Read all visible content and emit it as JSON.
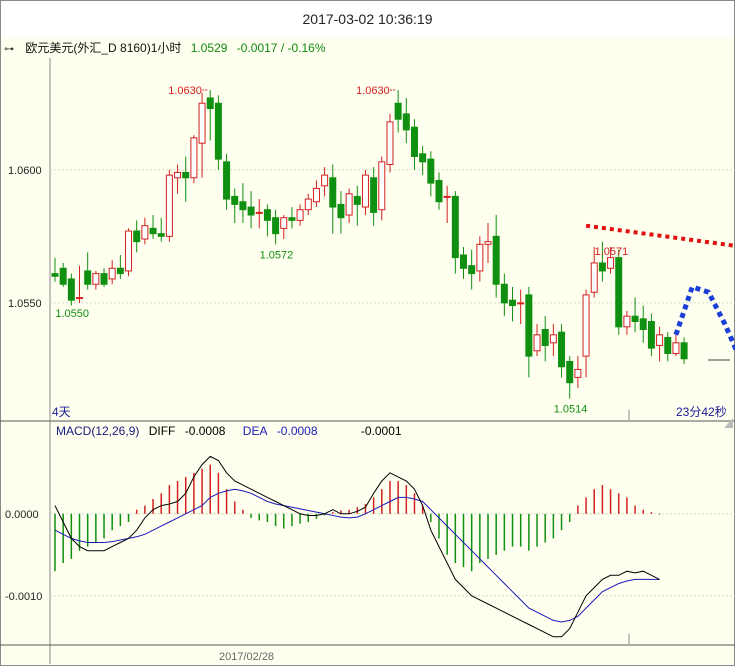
{
  "title": "2017-03-02 10:36:19",
  "header": {
    "symbol": "欧元美元(外汇_D 8160)1小时",
    "price": "1.0529",
    "change": "-0.0017 / -0.16%"
  },
  "macd_header": {
    "label": "MACD(12,26,9)",
    "diff_label": "DIFF",
    "diff_value": "-0.0008",
    "dea_label": "DEA",
    "dea_value": "-0.0008",
    "macd_value": "-0.0001"
  },
  "annotations": {
    "left_period": "4天",
    "countdown": "23分42秒",
    "date_tick": "2017/02/28"
  },
  "colors": {
    "up": "#d42020",
    "down": "#109010",
    "diff": "#000000",
    "dea": "#1a1ab8",
    "trend": "#e01010",
    "forecast": "#1a3fd8"
  },
  "chart_data": [
    {
      "type": "candlestick",
      "ylim": [
        1.0506,
        1.0642
      ],
      "yticks": [
        "1.0600",
        "1.0550"
      ],
      "labels": [
        {
          "text": "1.0630",
          "index": 19,
          "value": 1.063,
          "color": "red"
        },
        {
          "text": "1.0630",
          "index": 42,
          "value": 1.063,
          "color": "red"
        },
        {
          "text": "1.0571",
          "index": 68,
          "value": 1.0571,
          "color": "red"
        },
        {
          "text": "1.0572",
          "index": 27,
          "value": 1.0572,
          "color": "green"
        },
        {
          "text": "1.0550",
          "index": 2,
          "value": 1.055,
          "color": "green"
        },
        {
          "text": "1.0514",
          "index": 63,
          "value": 1.0514,
          "color": "green"
        }
      ],
      "candles": [
        [
          1.0561,
          1.0567,
          1.056,
          1.0558
        ],
        [
          1.0563,
          1.0565,
          1.0557,
          1.0556
        ],
        [
          1.0559,
          1.0561,
          1.0551,
          1.0549
        ],
        [
          1.0552,
          1.0564,
          1.0552,
          1.055
        ],
        [
          1.0562,
          1.0569,
          1.0557,
          1.0555
        ],
        [
          1.0557,
          1.0562,
          1.0561,
          1.0555
        ],
        [
          1.0561,
          1.0563,
          1.0557,
          1.0556
        ],
        [
          1.0559,
          1.0566,
          1.0563,
          1.0557
        ],
        [
          1.0563,
          1.0568,
          1.0561,
          1.0559
        ],
        [
          1.0562,
          1.0578,
          1.0577,
          1.056
        ],
        [
          1.0577,
          1.0581,
          1.0573,
          1.0569
        ],
        [
          1.0574,
          1.0582,
          1.0579,
          1.0572
        ],
        [
          1.0578,
          1.0583,
          1.0576,
          1.0574
        ],
        [
          1.0576,
          1.0582,
          1.0575,
          1.0573
        ],
        [
          1.0575,
          1.06,
          1.0598,
          1.0573
        ],
        [
          1.0597,
          1.0602,
          1.0599,
          1.0591
        ],
        [
          1.0599,
          1.0605,
          1.0597,
          1.0588
        ],
        [
          1.0597,
          1.0613,
          1.0612,
          1.0595
        ],
        [
          1.061,
          1.0629,
          1.0625,
          1.0597
        ],
        [
          1.0627,
          1.063,
          1.0623,
          1.0611
        ],
        [
          1.0625,
          1.0628,
          1.0604,
          1.06
        ],
        [
          1.0603,
          1.0606,
          1.0589,
          1.0585
        ],
        [
          1.059,
          1.0593,
          1.0587,
          1.058
        ],
        [
          1.0588,
          1.0595,
          1.0585,
          1.058
        ],
        [
          1.0586,
          1.0592,
          1.0583,
          1.0578
        ],
        [
          1.0584,
          1.0589,
          1.0584,
          1.0578
        ],
        [
          1.0585,
          1.0587,
          1.0581,
          1.0575
        ],
        [
          1.0582,
          1.0585,
          1.0576,
          1.0572
        ],
        [
          1.0578,
          1.0583,
          1.0582,
          1.0574
        ],
        [
          1.0582,
          1.0586,
          1.0581,
          1.0578
        ],
        [
          1.0581,
          1.0587,
          1.0585,
          1.0579
        ],
        [
          1.0585,
          1.0591,
          1.0589,
          1.0583
        ],
        [
          1.0588,
          1.0596,
          1.0593,
          1.0586
        ],
        [
          1.0594,
          1.0601,
          1.0598,
          1.059
        ],
        [
          1.0597,
          1.0602,
          1.0586,
          1.0576
        ],
        [
          1.0587,
          1.0592,
          1.0582,
          1.0576
        ],
        [
          1.0583,
          1.0593,
          1.0591,
          1.058
        ],
        [
          1.059,
          1.0594,
          1.0587,
          1.0579
        ],
        [
          1.0586,
          1.06,
          1.0598,
          1.0583
        ],
        [
          1.0597,
          1.0601,
          1.0584,
          1.0579
        ],
        [
          1.0585,
          1.0605,
          1.0603,
          1.0581
        ],
        [
          1.0602,
          1.0621,
          1.0618,
          1.0599
        ],
        [
          1.0625,
          1.063,
          1.0619,
          1.0614
        ],
        [
          1.0621,
          1.0627,
          1.0615,
          1.061
        ],
        [
          1.0616,
          1.0619,
          1.0605,
          1.06
        ],
        [
          1.0606,
          1.0609,
          1.0603,
          1.0598
        ],
        [
          1.0604,
          1.0607,
          1.0595,
          1.059
        ],
        [
          1.0596,
          1.0599,
          1.0588,
          1.0585
        ],
        [
          1.059,
          1.0594,
          1.059,
          1.058
        ],
        [
          1.059,
          1.0592,
          1.0567,
          1.0561
        ],
        [
          1.0568,
          1.0571,
          1.0563,
          1.0559
        ],
        [
          1.0564,
          1.057,
          1.0561,
          1.0555
        ],
        [
          1.0562,
          1.0575,
          1.0572,
          1.0558
        ],
        [
          1.0572,
          1.058,
          1.0573,
          1.0565
        ],
        [
          1.0575,
          1.0583,
          1.0557,
          1.0552
        ],
        [
          1.0557,
          1.0561,
          1.055,
          1.0545
        ],
        [
          1.0551,
          1.0556,
          1.0549,
          1.0543
        ],
        [
          1.055,
          1.0555,
          1.055,
          1.0542
        ],
        [
          1.0553,
          1.0556,
          1.053,
          1.0522
        ],
        [
          1.0532,
          1.0542,
          1.0538,
          1.053
        ],
        [
          1.054,
          1.0545,
          1.0534,
          1.0528
        ],
        [
          1.0535,
          1.0542,
          1.0538,
          1.053
        ],
        [
          1.0539,
          1.0542,
          1.0526,
          1.0522
        ],
        [
          1.0528,
          1.053,
          1.052,
          1.0514
        ],
        [
          1.0522,
          1.053,
          1.0525,
          1.0518
        ],
        [
          1.053,
          1.0555,
          1.0553,
          1.0522
        ],
        [
          1.0554,
          1.0571,
          1.0565,
          1.0552
        ],
        [
          1.0565,
          1.0573,
          1.0562,
          1.0558
        ],
        [
          1.0563,
          1.0571,
          1.0567,
          1.0561
        ],
        [
          1.0567,
          1.057,
          1.0541,
          1.0538
        ],
        [
          1.0541,
          1.0547,
          1.0545,
          1.0538
        ],
        [
          1.0545,
          1.0552,
          1.0543,
          1.0539
        ],
        [
          1.0544,
          1.0549,
          1.054,
          1.0535
        ],
        [
          1.0543,
          1.0546,
          1.0533,
          1.053
        ],
        [
          1.0534,
          1.0541,
          1.0538,
          1.0528
        ],
        [
          1.0537,
          1.0539,
          1.0531,
          1.0528
        ],
        [
          1.0531,
          1.0538,
          1.0535,
          1.053
        ],
        [
          1.0535,
          1.0537,
          1.0529,
          1.0527
        ]
      ],
      "trendline": {
        "from": {
          "index": 65,
          "value": 1.0579
        },
        "to": {
          "index": 94,
          "value": 1.0567
        }
      },
      "forecast": {
        "points": [
          [
            1.0538,
            76
          ],
          [
            1.0556,
            78
          ],
          [
            1.0554,
            80
          ],
          [
            1.0542,
            82
          ],
          [
            1.0528,
            84
          ],
          [
            1.0518,
            85
          ]
        ]
      }
    },
    {
      "type": "macd",
      "ylim": [
        -0.0016,
        0.0009
      ],
      "yticks": [
        "0.0000",
        "-0.0010"
      ],
      "macd_hist": [
        -0.0007,
        -0.0006,
        -0.00055,
        -0.00045,
        -0.0004,
        -0.00035,
        -0.0003,
        -0.0002,
        -0.00015,
        -0.0001,
        5e-05,
        0.0001,
        0.00018,
        0.00025,
        0.00035,
        0.0004,
        0.00045,
        0.0005,
        0.00055,
        0.0006,
        0.0005,
        0.0003,
        0.00015,
        5e-05,
        -5e-05,
        -8e-05,
        -0.0001,
        -0.00015,
        -0.00018,
        -0.00015,
        -0.00012,
        -0.0001,
        -6e-05,
        -2e-05,
        2e-05,
        4e-05,
        5e-05,
        8e-05,
        0.00012,
        0.0002,
        0.0003,
        0.0004,
        0.0004,
        0.00035,
        0.00025,
        0.0001,
        -0.0001,
        -0.0003,
        -0.0005,
        -0.0006,
        -0.00065,
        -0.0007,
        -0.0006,
        -0.00055,
        -0.0005,
        -0.00045,
        -0.0004,
        -0.0004,
        -0.00045,
        -0.0004,
        -0.00035,
        -0.0003,
        -0.0002,
        -0.0001,
        0.0001,
        0.0002,
        0.0003,
        0.00035,
        0.0003,
        0.00025,
        0.0002,
        0.0001,
        5e-05,
        2e-05,
        -1e-05
      ],
      "diff": [
        0.0001,
        -0.0001,
        -0.0003,
        -0.0004,
        -0.00045,
        -0.00045,
        -0.00045,
        -0.0004,
        -0.00035,
        -0.0003,
        -0.0002,
        -5e-05,
        5e-05,
        0.0001,
        0.00012,
        0.00015,
        0.00025,
        0.00045,
        0.0006,
        0.0007,
        0.00065,
        0.0005,
        0.0004,
        0.00035,
        0.0003,
        0.00025,
        0.0002,
        0.00015,
        0.0001,
        5e-05,
        0.0,
        -2e-05,
        -2e-05,
        0.0,
        5e-05,
        0.0,
        0.0,
        3e-05,
        8e-05,
        0.00025,
        0.0004,
        0.0005,
        0.00045,
        0.0004,
        0.0003,
        0.0001,
        -0.0002,
        -0.0004,
        -0.0006,
        -0.0008,
        -0.0009,
        -0.001,
        -0.00105,
        -0.0011,
        -0.00115,
        -0.0012,
        -0.00125,
        -0.0013,
        -0.00135,
        -0.0014,
        -0.00145,
        -0.0015,
        -0.0015,
        -0.0014,
        -0.0012,
        -0.001,
        -0.0009,
        -0.0008,
        -0.00075,
        -0.00075,
        -0.0007,
        -0.00072,
        -0.0007,
        -0.00075,
        -0.0008
      ],
      "dea": [
        -0.0002,
        -0.00025,
        -0.0003,
        -0.00033,
        -0.00035,
        -0.00035,
        -0.00035,
        -0.00034,
        -0.00032,
        -0.0003,
        -0.00028,
        -0.00025,
        -0.0002,
        -0.00015,
        -0.0001,
        -5e-05,
        0.0,
        5e-05,
        0.0001,
        0.0002,
        0.00025,
        0.00028,
        0.0003,
        0.00028,
        0.00025,
        0.0002,
        0.00015,
        0.00012,
        0.0001,
        8e-05,
        6e-05,
        4e-05,
        2e-05,
        0.0,
        -2e-05,
        -4e-05,
        -5e-05,
        -4e-05,
        0.0,
        5e-05,
        0.0001,
        0.00015,
        0.0002,
        0.0002,
        0.00018,
        0.00015,
        5e-05,
        -5e-05,
        -0.00015,
        -0.00025,
        -0.00035,
        -0.00045,
        -0.00055,
        -0.00065,
        -0.00075,
        -0.00085,
        -0.00095,
        -0.00105,
        -0.00115,
        -0.0012,
        -0.00125,
        -0.0013,
        -0.00132,
        -0.0013,
        -0.00125,
        -0.00115,
        -0.00105,
        -0.00095,
        -0.0009,
        -0.00085,
        -0.00082,
        -0.0008,
        -0.0008,
        -0.0008,
        -0.0008
      ]
    }
  ]
}
